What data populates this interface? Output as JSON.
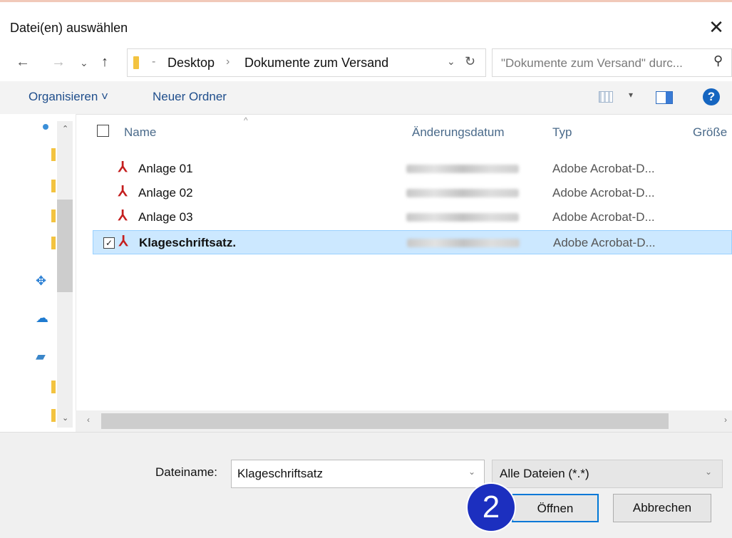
{
  "window": {
    "title": "Datei(en) auswählen",
    "close_label": "✕"
  },
  "address": {
    "breadcrumbs": [
      "Desktop",
      "Dokumente zum Versand"
    ],
    "search_placeholder": "\"Dokumente zum Versand\" durc..."
  },
  "toolbar": {
    "organize_label": "Organisieren ˅",
    "new_folder_label": "Neuer Ordner",
    "help_label": "?"
  },
  "columns": {
    "name": "Name",
    "date": "Änderungsdatum",
    "type": "Typ",
    "size": "Größe"
  },
  "files": [
    {
      "name": "Anlage 01",
      "type": "Adobe Acrobat-D...",
      "selected": false
    },
    {
      "name": "Anlage 02",
      "type": "Adobe Acrobat-D...",
      "selected": false
    },
    {
      "name": "Anlage 03",
      "type": "Adobe Acrobat-D...",
      "selected": false
    },
    {
      "name": "Klageschriftsatz.",
      "type": "Adobe Acrobat-D...",
      "selected": true
    }
  ],
  "footer": {
    "filename_label": "Dateiname:",
    "filename_value": "Klageschriftsatz",
    "filter_value": "Alle Dateien (*.*)",
    "open_label": "Öffnen",
    "cancel_label": "Abbrechen"
  },
  "annotation": {
    "step_number": "2",
    "color": "#1c2fbf"
  },
  "colors": {
    "selection": "#cce8ff",
    "link_blue": "#1f4e8c",
    "accent": "#0078d7"
  },
  "icons": {
    "nav": [
      "folder-icon",
      "dropbox-icon",
      "onedrive-icon",
      "this-pc-icon"
    ],
    "file": "pdf-icon"
  }
}
